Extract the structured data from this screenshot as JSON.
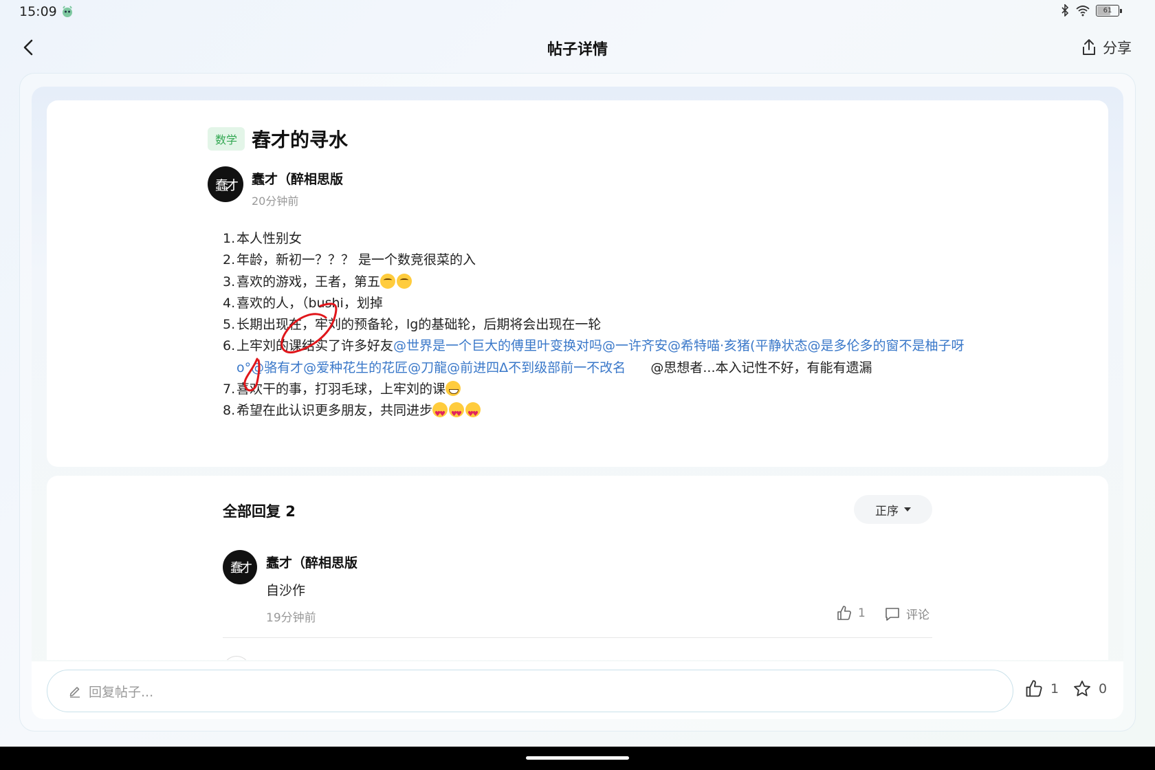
{
  "status_bar": {
    "time": "15:09",
    "battery": "61"
  },
  "header": {
    "title": "帖子详情",
    "share_label": "分享"
  },
  "post": {
    "tag": "数学",
    "title": "舂才的寻水",
    "author": {
      "name": "蠢才（醉相思版",
      "time": "20分钟前",
      "avatar_glyph": "蠢才"
    },
    "items": [
      {
        "num": "1.",
        "text": "本人性别女"
      },
      {
        "num": "2.",
        "text": "年龄，新初一？？？ 是一个数竞很菜的入"
      },
      {
        "num": "3.",
        "text": "喜欢的游戏，王者，第五"
      },
      {
        "num": "4.",
        "text": " 喜欢的人，（bushi，划掉"
      },
      {
        "num": "5.",
        "text": "长期出现在，牢刘的预备轮，lg的基础轮，后期将会出现在一轮"
      },
      {
        "num": "6.",
        "text": "上牢刘的课结实了许多好友",
        "mentions": "@世界是一个巨大的傅里叶变换对吗@一许齐安@希特喵·亥猪(平静状态@是多伦多的窗不是柚子呀o°@骆有才@爱种花生的花匠@刀龍@前进四Δ不到级部前一不改名",
        "tail": "      @思想者...本入记性不好，有能有遗漏"
      },
      {
        "num": "7.",
        "text": "喜欢干的事，打羽毛球，上牢刘的课"
      },
      {
        "num": "8.",
        "text": "希望在此认识更多朋友，共同进步"
      }
    ]
  },
  "replies": {
    "header": "全部回复 2",
    "sort_label": "正序",
    "items": [
      {
        "author": "蠢才（醉相思版",
        "text": "自沙作",
        "time": "19分钟前",
        "likes": "1",
        "comment_label": "评论",
        "avatar_glyph": "蠢才"
      }
    ]
  },
  "input_bar": {
    "placeholder": "回复帖子...",
    "likes": "1",
    "favorites": "0"
  },
  "colors": {
    "accent_blue": "#3a78c9",
    "tag_green": "#34a853",
    "annotation_red": "#e0161b"
  }
}
